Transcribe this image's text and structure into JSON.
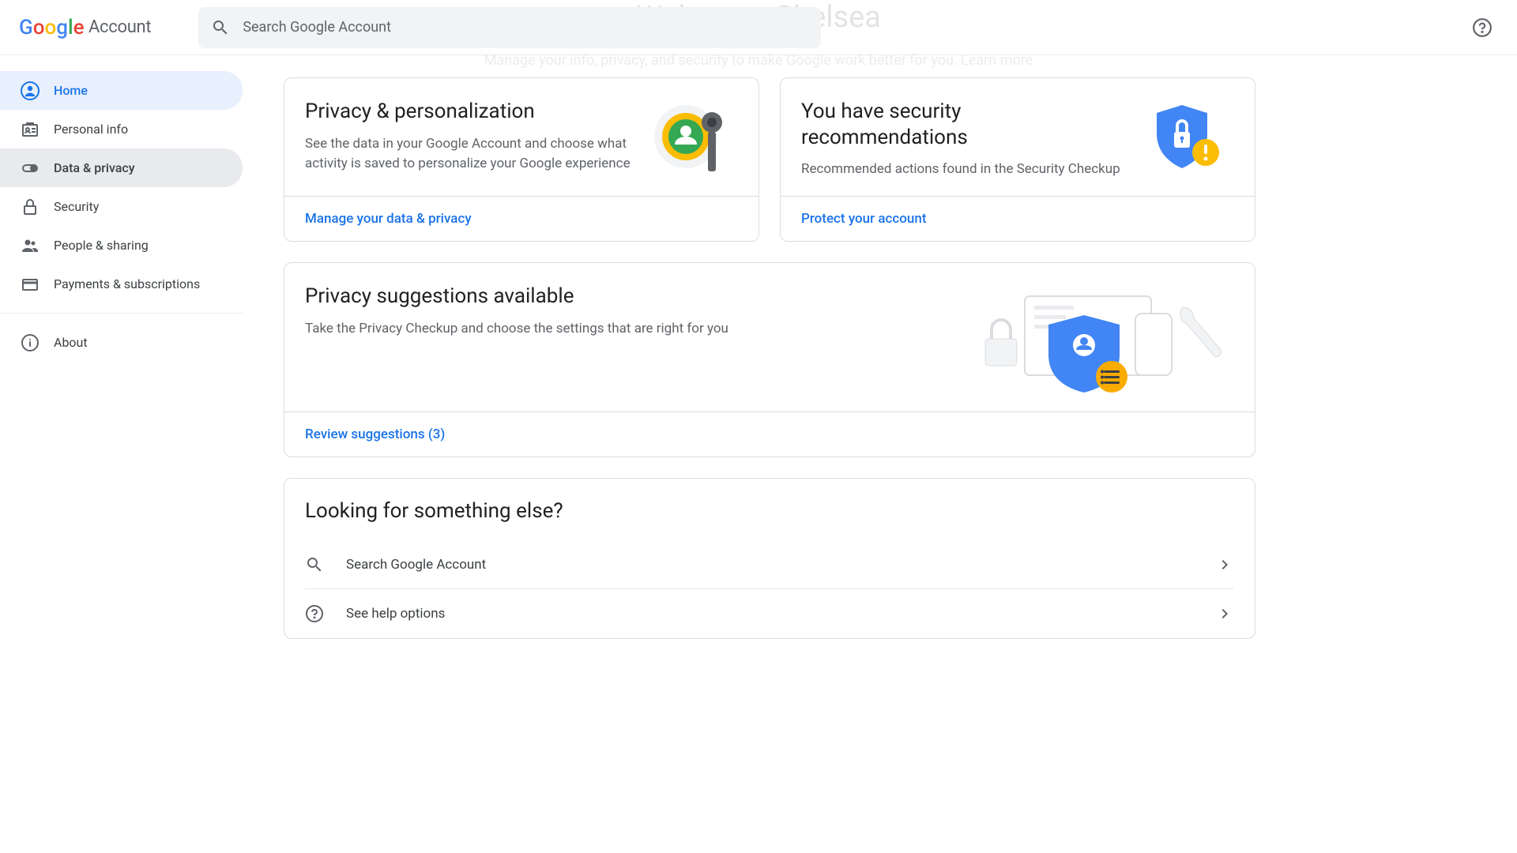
{
  "header": {
    "logo_suffix": "Account",
    "search_placeholder": "Search Google Account"
  },
  "faded": {
    "title": "Welcome, Chelsea",
    "subtitle": "Manage your info, privacy, and security to make Google work better for you. Learn more"
  },
  "sidebar": {
    "items": [
      {
        "label": "Home"
      },
      {
        "label": "Personal info"
      },
      {
        "label": "Data & privacy"
      },
      {
        "label": "Security"
      },
      {
        "label": "People & sharing"
      },
      {
        "label": "Payments & subscriptions"
      },
      {
        "label": "About"
      }
    ]
  },
  "cards": {
    "privacy": {
      "title": "Privacy & personalization",
      "desc": "See the data in your Google Account and choose what activity is saved to personalize your Google experience",
      "action": "Manage your data & privacy"
    },
    "security": {
      "title": "You have security recommendations",
      "desc": "Recommended actions found in the Security Checkup",
      "action": "Protect your account"
    },
    "suggestions": {
      "title": "Privacy suggestions available",
      "desc": "Take the Privacy Checkup and choose the settings that are right for you",
      "action": "Review suggestions (3)"
    }
  },
  "looking": {
    "title": "Looking for something else?",
    "options": [
      {
        "label": "Search Google Account"
      },
      {
        "label": "See help options"
      }
    ]
  }
}
